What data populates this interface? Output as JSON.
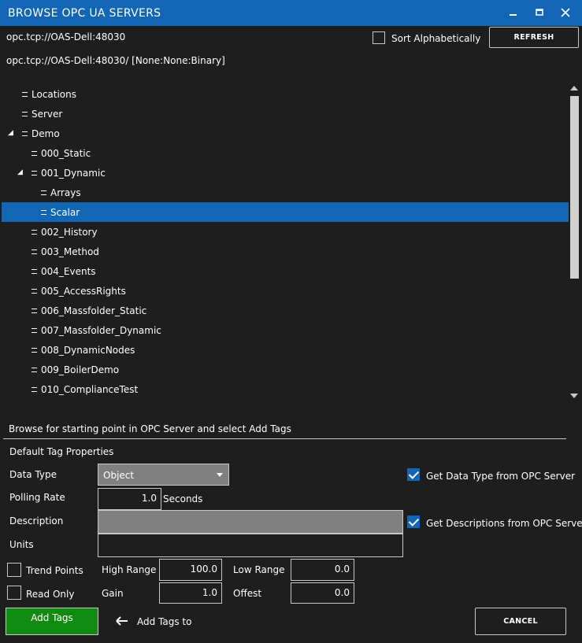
{
  "window": {
    "title": "BROWSE OPC UA SERVERS",
    "minimize_glyph": "–",
    "maximize_glyph": "□",
    "close_glyph": "✕"
  },
  "server": {
    "url": "opc.tcp://OAS-Dell:48030",
    "endpoint": "opc.tcp://OAS-Dell:48030/ [None:None:Binary]"
  },
  "sort_alphabetically": {
    "label": "Sort Alphabetically",
    "checked": false
  },
  "refresh_label": "REFRESH",
  "tree": {
    "items": [
      {
        "label": "Locations",
        "level": 0,
        "expanded": false,
        "selected": false
      },
      {
        "label": "Server",
        "level": 0,
        "expanded": false,
        "selected": false
      },
      {
        "label": "Demo",
        "level": 0,
        "expanded": true,
        "selected": false
      },
      {
        "label": "000_Static",
        "level": 1,
        "expanded": false,
        "selected": false
      },
      {
        "label": "001_Dynamic",
        "level": 1,
        "expanded": true,
        "selected": false
      },
      {
        "label": "Arrays",
        "level": 2,
        "expanded": false,
        "selected": false
      },
      {
        "label": "Scalar",
        "level": 2,
        "expanded": false,
        "selected": true
      },
      {
        "label": "002_History",
        "level": 1,
        "expanded": false,
        "selected": false
      },
      {
        "label": "003_Method",
        "level": 1,
        "expanded": false,
        "selected": false
      },
      {
        "label": "004_Events",
        "level": 1,
        "expanded": false,
        "selected": false
      },
      {
        "label": "005_AccessRights",
        "level": 1,
        "expanded": false,
        "selected": false
      },
      {
        "label": "006_Massfolder_Static",
        "level": 1,
        "expanded": false,
        "selected": false
      },
      {
        "label": "007_Massfolder_Dynamic",
        "level": 1,
        "expanded": false,
        "selected": false
      },
      {
        "label": "008_DynamicNodes",
        "level": 1,
        "expanded": false,
        "selected": false
      },
      {
        "label": "009_BoilerDemo",
        "level": 1,
        "expanded": false,
        "selected": false
      },
      {
        "label": "010_ComplianceTest",
        "level": 1,
        "expanded": false,
        "selected": false
      }
    ],
    "expanded_glyph": "◢"
  },
  "instructions": "Browse for starting point in OPC Server and select Add Tags",
  "defaults": {
    "section_title": "Default Tag Properties",
    "data_type": {
      "label": "Data Type",
      "value": "Object"
    },
    "polling_rate": {
      "label": "Polling Rate",
      "value": "1.0",
      "unit": "Seconds"
    },
    "description": {
      "label": "Description",
      "value": ""
    },
    "units": {
      "label": "Units",
      "value": ""
    },
    "get_data_type": {
      "label": "Get Data Type from OPC Server",
      "checked": true
    },
    "get_descriptions": {
      "label": "Get Descriptions from OPC Serve",
      "checked": true
    },
    "trend_points": {
      "label": "Trend Points",
      "checked": false
    },
    "read_only": {
      "label": "Read Only",
      "checked": false
    },
    "high_range": {
      "label": "High Range",
      "value": "100.0"
    },
    "low_range": {
      "label": "Low Range",
      "value": "0.0"
    },
    "gain": {
      "label": "Gain",
      "value": "1.0"
    },
    "offset": {
      "label": "Offest",
      "value": "0.0"
    }
  },
  "actions": {
    "add_tags_label": "Add Tags",
    "add_tags_to_label": "Add Tags to",
    "cancel_label": "CANCEL",
    "arrow_glyph": "🠠"
  },
  "colors": {
    "title_bar": "#1266b4",
    "selection": "#1266b4",
    "background": "#1e1e1e",
    "add_button": "#108a10"
  }
}
